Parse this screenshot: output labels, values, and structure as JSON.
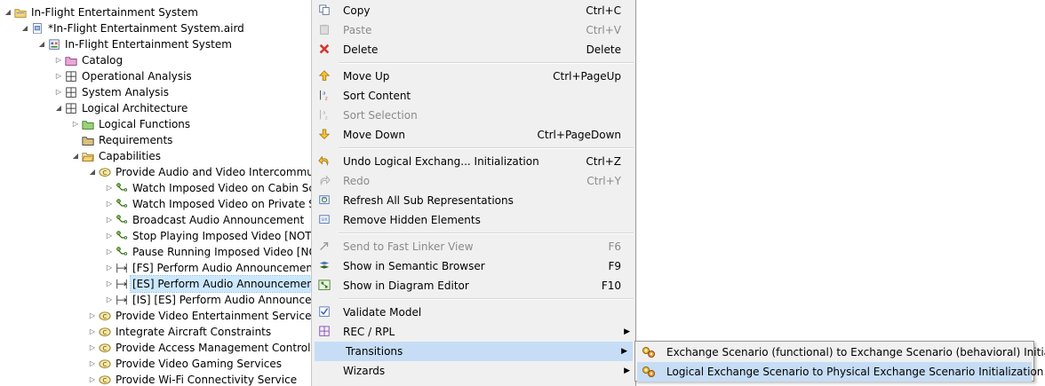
{
  "tree": {
    "items": [
      {
        "label": "In-Flight Entertainment System",
        "indent": 0,
        "toggle": "open",
        "icon": "folder-project-icon"
      },
      {
        "label": "*In-Flight Entertainment System.aird",
        "indent": 1,
        "toggle": "open",
        "icon": "aird-file-icon"
      },
      {
        "label": "In-Flight Entertainment System",
        "indent": 2,
        "toggle": "open",
        "icon": "system-model-icon"
      },
      {
        "label": "Catalog",
        "indent": 3,
        "toggle": "closed",
        "icon": "folder-pink-icon"
      },
      {
        "label": "Operational Analysis",
        "indent": 3,
        "toggle": "closed",
        "icon": "grid-icon"
      },
      {
        "label": "System Analysis",
        "indent": 3,
        "toggle": "closed",
        "icon": "grid-icon"
      },
      {
        "label": "Logical Architecture",
        "indent": 3,
        "toggle": "open",
        "icon": "grid-icon"
      },
      {
        "label": "Logical Functions",
        "indent": 4,
        "toggle": "closed",
        "icon": "folder-green-icon"
      },
      {
        "label": "Requirements",
        "indent": 4,
        "toggle": "none",
        "icon": "folder-dark-icon"
      },
      {
        "label": "Capabilities",
        "indent": 4,
        "toggle": "open",
        "icon": "folder-open-icon"
      },
      {
        "label": "Provide Audio and Video Intercommur",
        "indent": 5,
        "toggle": "open",
        "icon": "capability-icon"
      },
      {
        "label": "Watch Imposed Video on Cabin Scr",
        "indent": 6,
        "toggle": "closed",
        "icon": "scenario-icon"
      },
      {
        "label": "Watch Imposed Video on Private Sc",
        "indent": 6,
        "toggle": "closed",
        "icon": "scenario-icon"
      },
      {
        "label": "Broadcast Audio Announcement",
        "indent": 6,
        "toggle": "closed",
        "icon": "scenario-icon"
      },
      {
        "label": "Stop Playing Imposed Video [NOT I",
        "indent": 6,
        "toggle": "closed",
        "icon": "scenario-icon"
      },
      {
        "label": "Pause Running Imposed Video [NO",
        "indent": 6,
        "toggle": "closed",
        "icon": "scenario-icon"
      },
      {
        "label": "[FS] Perform Audio Announcement",
        "indent": 6,
        "toggle": "closed",
        "icon": "exchange-scenario-icon"
      },
      {
        "label": "[ES] Perform Audio Announcement",
        "indent": 6,
        "toggle": "closed",
        "icon": "exchange-scenario-icon",
        "selected": true
      },
      {
        "label": "[IS] [ES] Perform Audio Announcen",
        "indent": 6,
        "toggle": "closed",
        "icon": "exchange-scenario-icon"
      },
      {
        "label": "Provide Video Entertainment Services",
        "indent": 5,
        "toggle": "closed",
        "icon": "capability-icon"
      },
      {
        "label": "Integrate Aircraft Constraints",
        "indent": 5,
        "toggle": "closed",
        "icon": "capability-icon"
      },
      {
        "label": "Provide Access Management Control",
        "indent": 5,
        "toggle": "closed",
        "icon": "capability-icon"
      },
      {
        "label": "Provide Video Gaming Services",
        "indent": 5,
        "toggle": "closed",
        "icon": "capability-icon"
      },
      {
        "label": "Provide Wi-Fi Connectivity Service",
        "indent": 5,
        "toggle": "closed",
        "icon": "capability-icon"
      }
    ]
  },
  "menu": {
    "items": [
      {
        "type": "item",
        "label": "Copy",
        "shortcut": "Ctrl+C",
        "icon": "copy-icon"
      },
      {
        "type": "item",
        "label": "Paste",
        "shortcut": "Ctrl+V",
        "icon": "paste-icon",
        "disabled": true
      },
      {
        "type": "item",
        "label": "Delete",
        "shortcut": "Delete",
        "icon": "delete-icon"
      },
      {
        "type": "sep"
      },
      {
        "type": "item",
        "label": "Move Up",
        "shortcut": "Ctrl+PageUp",
        "icon": "arrow-up-icon"
      },
      {
        "type": "item",
        "label": "Sort Content",
        "shortcut": "",
        "icon": "sort-az-icon"
      },
      {
        "type": "item",
        "label": "Sort Selection",
        "shortcut": "",
        "icon": "sort-selection-icon",
        "disabled": true
      },
      {
        "type": "item",
        "label": "Move Down",
        "shortcut": "Ctrl+PageDown",
        "icon": "arrow-down-icon"
      },
      {
        "type": "sep"
      },
      {
        "type": "item",
        "label": "Undo Logical Exchang... Initialization",
        "shortcut": "Ctrl+Z",
        "icon": "undo-icon"
      },
      {
        "type": "item",
        "label": "Redo",
        "shortcut": "Ctrl+Y",
        "icon": "redo-icon",
        "disabled": true
      },
      {
        "type": "item",
        "label": "Refresh All Sub Representations",
        "shortcut": "",
        "icon": "refresh-representations-icon"
      },
      {
        "type": "item",
        "label": "Remove Hidden Elements",
        "shortcut": "",
        "icon": "remove-hidden-icon"
      },
      {
        "type": "sep"
      },
      {
        "type": "item",
        "label": "Send to Fast Linker View",
        "shortcut": "F6",
        "icon": "fast-linker-icon",
        "disabled": true
      },
      {
        "type": "item",
        "label": "Show in Semantic Browser",
        "shortcut": "F9",
        "icon": "semantic-browser-icon"
      },
      {
        "type": "item",
        "label": "Show in Diagram Editor",
        "shortcut": "F10",
        "icon": "diagram-editor-icon"
      },
      {
        "type": "sep"
      },
      {
        "type": "item",
        "label": "Validate Model",
        "shortcut": "",
        "icon": "validate-icon"
      },
      {
        "type": "item",
        "label": "REC / RPL",
        "shortcut": "",
        "icon": "rec-rpl-icon",
        "submenu": true
      },
      {
        "type": "item",
        "label": "Transitions",
        "shortcut": "",
        "icon": "",
        "submenu": true,
        "highlighted": true
      },
      {
        "type": "item",
        "label": "Wizards",
        "shortcut": "",
        "icon": "",
        "submenu": true
      }
    ]
  },
  "submenu": {
    "items": [
      {
        "label": "Exchange Scenario (functional) to Exchange Scenario (behavioral) Initialization",
        "icon": "transition-gears-icon"
      },
      {
        "label": "Logical Exchange Scenario to Physical Exchange Scenario Initialization",
        "icon": "transition-gears-icon",
        "highlighted": true
      }
    ]
  },
  "colors": {
    "menu_bg": "#f0f0f0",
    "highlight": "#c6ddf5",
    "selection": "#cce8ff",
    "disabled_text": "#8a8a8a"
  }
}
